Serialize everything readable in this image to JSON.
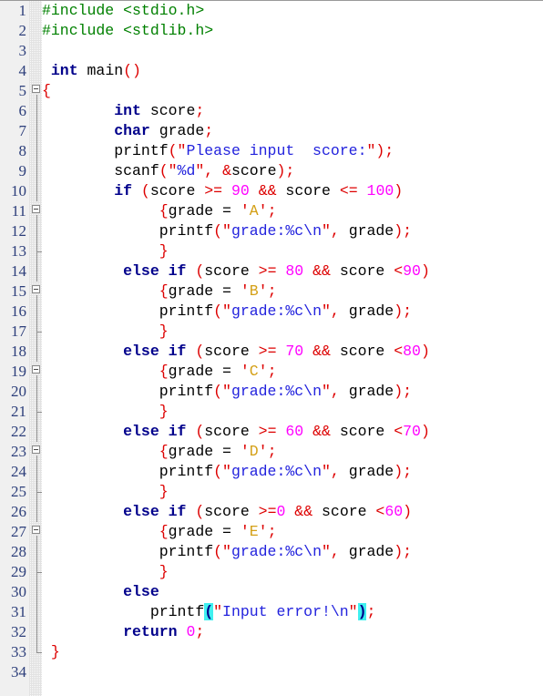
{
  "editor": {
    "language": "C",
    "gutter_background": "#F0F0F0",
    "code_background": "#FFFFFF",
    "line_height_px": 22,
    "total_visible_lines": 34,
    "bracket_match_highlight_color": "#3FF0F0",
    "colors": {
      "preprocessor": "#008000",
      "keyword": "#00008B",
      "identifier": "#000000",
      "punctuation": "#DD0000",
      "string": "#2222DD",
      "char_literal": "#D4A017",
      "number": "#FF00FF",
      "line_number": "#2C3E7A",
      "fold_line": "#8A8A8A"
    },
    "line_numbers": [
      "1",
      "2",
      "3",
      "4",
      "5",
      "6",
      "7",
      "8",
      "9",
      "10",
      "11",
      "12",
      "13",
      "14",
      "15",
      "16",
      "17",
      "18",
      "19",
      "20",
      "21",
      "22",
      "23",
      "24",
      "25",
      "26",
      "27",
      "28",
      "29",
      "30",
      "31",
      "32",
      "33",
      "34"
    ],
    "fold_markers": [
      {
        "line": 5,
        "type": "box",
        "state": "expanded"
      },
      {
        "line": 11,
        "type": "box",
        "state": "expanded"
      },
      {
        "line": 13,
        "type": "endtick",
        "state": "region-end"
      },
      {
        "line": 15,
        "type": "box",
        "state": "expanded"
      },
      {
        "line": 17,
        "type": "endtick",
        "state": "region-end"
      },
      {
        "line": 19,
        "type": "box",
        "state": "expanded"
      },
      {
        "line": 21,
        "type": "endtick",
        "state": "region-end"
      },
      {
        "line": 23,
        "type": "box",
        "state": "expanded"
      },
      {
        "line": 25,
        "type": "endtick",
        "state": "region-end"
      },
      {
        "line": 27,
        "type": "box",
        "state": "expanded"
      },
      {
        "line": 29,
        "type": "endtick",
        "state": "region-end"
      },
      {
        "line": 33,
        "type": "elbow",
        "state": "region-end"
      }
    ],
    "lines": [
      {
        "n": 1,
        "text": "#include <stdio.h>",
        "tokens": [
          {
            "t": "#include <stdio.h>",
            "c": "t-pre"
          }
        ]
      },
      {
        "n": 2,
        "text": "#include <stdlib.h>",
        "tokens": [
          {
            "t": "#include <stdlib.h>",
            "c": "t-pre"
          }
        ]
      },
      {
        "n": 3,
        "text": "",
        "tokens": []
      },
      {
        "n": 4,
        "text": " int main()",
        "tokens": [
          {
            "t": " ",
            "c": "t-id"
          },
          {
            "t": "int",
            "c": "t-kw"
          },
          {
            "t": " main",
            "c": "t-id"
          },
          {
            "t": "()",
            "c": "t-punct"
          }
        ]
      },
      {
        "n": 5,
        "text": "{",
        "tokens": [
          {
            "t": "{",
            "c": "t-punct"
          }
        ]
      },
      {
        "n": 6,
        "text": "        int score;",
        "tokens": [
          {
            "t": "        ",
            "c": "t-id"
          },
          {
            "t": "int",
            "c": "t-kw"
          },
          {
            "t": " score",
            "c": "t-id"
          },
          {
            "t": ";",
            "c": "t-punct"
          }
        ]
      },
      {
        "n": 7,
        "text": "        char grade;",
        "tokens": [
          {
            "t": "        ",
            "c": "t-id"
          },
          {
            "t": "char",
            "c": "t-kw"
          },
          {
            "t": " grade",
            "c": "t-id"
          },
          {
            "t": ";",
            "c": "t-punct"
          }
        ]
      },
      {
        "n": 8,
        "text": "        printf(\"Please input  score:\");",
        "tokens": [
          {
            "t": "        printf",
            "c": "t-id"
          },
          {
            "t": "(\"",
            "c": "t-punct"
          },
          {
            "t": "Please input  score:",
            "c": "t-str"
          },
          {
            "t": "\");",
            "c": "t-punct"
          }
        ]
      },
      {
        "n": 9,
        "text": "        scanf(\"%d\", &score);",
        "tokens": [
          {
            "t": "        scanf",
            "c": "t-id"
          },
          {
            "t": "(\"",
            "c": "t-punct"
          },
          {
            "t": "%d",
            "c": "t-str"
          },
          {
            "t": "\", &",
            "c": "t-punct"
          },
          {
            "t": "score",
            "c": "t-id"
          },
          {
            "t": ");",
            "c": "t-punct"
          }
        ]
      },
      {
        "n": 10,
        "text": "        if (score >= 90 && score <= 100)",
        "tokens": [
          {
            "t": "        ",
            "c": "t-id"
          },
          {
            "t": "if",
            "c": "t-kw"
          },
          {
            "t": " (",
            "c": "t-punct"
          },
          {
            "t": "score ",
            "c": "t-id"
          },
          {
            "t": ">=",
            "c": "t-punct"
          },
          {
            "t": " ",
            "c": "t-id"
          },
          {
            "t": "90",
            "c": "t-num"
          },
          {
            "t": " ",
            "c": "t-id"
          },
          {
            "t": "&&",
            "c": "t-punct"
          },
          {
            "t": " score ",
            "c": "t-id"
          },
          {
            "t": "<=",
            "c": "t-punct"
          },
          {
            "t": " ",
            "c": "t-id"
          },
          {
            "t": "100",
            "c": "t-num"
          },
          {
            "t": ")",
            "c": "t-punct"
          }
        ]
      },
      {
        "n": 11,
        "text": "             {grade = 'A';",
        "tokens": [
          {
            "t": "             ",
            "c": "t-id"
          },
          {
            "t": "{",
            "c": "t-punct"
          },
          {
            "t": "grade = ",
            "c": "t-id"
          },
          {
            "t": "'",
            "c": "t-punct"
          },
          {
            "t": "A",
            "c": "t-chr"
          },
          {
            "t": "';",
            "c": "t-punct"
          }
        ]
      },
      {
        "n": 12,
        "text": "             printf(\"grade:%c\\n\", grade);",
        "tokens": [
          {
            "t": "             printf",
            "c": "t-id"
          },
          {
            "t": "(\"",
            "c": "t-punct"
          },
          {
            "t": "grade:%c\\n",
            "c": "t-str"
          },
          {
            "t": "\", ",
            "c": "t-punct"
          },
          {
            "t": "grade",
            "c": "t-id"
          },
          {
            "t": ");",
            "c": "t-punct"
          }
        ]
      },
      {
        "n": 13,
        "text": "             }",
        "tokens": [
          {
            "t": "             ",
            "c": "t-id"
          },
          {
            "t": "}",
            "c": "t-punct"
          }
        ]
      },
      {
        "n": 14,
        "text": "         else if (score >= 80 && score <90)",
        "tokens": [
          {
            "t": "         ",
            "c": "t-id"
          },
          {
            "t": "else if",
            "c": "t-kw"
          },
          {
            "t": " (",
            "c": "t-punct"
          },
          {
            "t": "score ",
            "c": "t-id"
          },
          {
            "t": ">=",
            "c": "t-punct"
          },
          {
            "t": " ",
            "c": "t-id"
          },
          {
            "t": "80",
            "c": "t-num"
          },
          {
            "t": " ",
            "c": "t-id"
          },
          {
            "t": "&&",
            "c": "t-punct"
          },
          {
            "t": " score ",
            "c": "t-id"
          },
          {
            "t": "<",
            "c": "t-punct"
          },
          {
            "t": "90",
            "c": "t-num"
          },
          {
            "t": ")",
            "c": "t-punct"
          }
        ]
      },
      {
        "n": 15,
        "text": "             {grade = 'B';",
        "tokens": [
          {
            "t": "             ",
            "c": "t-id"
          },
          {
            "t": "{",
            "c": "t-punct"
          },
          {
            "t": "grade = ",
            "c": "t-id"
          },
          {
            "t": "'",
            "c": "t-punct"
          },
          {
            "t": "B",
            "c": "t-chr"
          },
          {
            "t": "';",
            "c": "t-punct"
          }
        ]
      },
      {
        "n": 16,
        "text": "             printf(\"grade:%c\\n\", grade);",
        "tokens": [
          {
            "t": "             printf",
            "c": "t-id"
          },
          {
            "t": "(\"",
            "c": "t-punct"
          },
          {
            "t": "grade:%c\\n",
            "c": "t-str"
          },
          {
            "t": "\", ",
            "c": "t-punct"
          },
          {
            "t": "grade",
            "c": "t-id"
          },
          {
            "t": ");",
            "c": "t-punct"
          }
        ]
      },
      {
        "n": 17,
        "text": "             }",
        "tokens": [
          {
            "t": "             ",
            "c": "t-id"
          },
          {
            "t": "}",
            "c": "t-punct"
          }
        ]
      },
      {
        "n": 18,
        "text": "         else if (score >= 70 && score <80)",
        "tokens": [
          {
            "t": "         ",
            "c": "t-id"
          },
          {
            "t": "else if",
            "c": "t-kw"
          },
          {
            "t": " (",
            "c": "t-punct"
          },
          {
            "t": "score ",
            "c": "t-id"
          },
          {
            "t": ">=",
            "c": "t-punct"
          },
          {
            "t": " ",
            "c": "t-id"
          },
          {
            "t": "70",
            "c": "t-num"
          },
          {
            "t": " ",
            "c": "t-id"
          },
          {
            "t": "&&",
            "c": "t-punct"
          },
          {
            "t": " score ",
            "c": "t-id"
          },
          {
            "t": "<",
            "c": "t-punct"
          },
          {
            "t": "80",
            "c": "t-num"
          },
          {
            "t": ")",
            "c": "t-punct"
          }
        ]
      },
      {
        "n": 19,
        "text": "             {grade = 'C';",
        "tokens": [
          {
            "t": "             ",
            "c": "t-id"
          },
          {
            "t": "{",
            "c": "t-punct"
          },
          {
            "t": "grade = ",
            "c": "t-id"
          },
          {
            "t": "'",
            "c": "t-punct"
          },
          {
            "t": "C",
            "c": "t-chr"
          },
          {
            "t": "';",
            "c": "t-punct"
          }
        ]
      },
      {
        "n": 20,
        "text": "             printf(\"grade:%c\\n\", grade);",
        "tokens": [
          {
            "t": "             printf",
            "c": "t-id"
          },
          {
            "t": "(\"",
            "c": "t-punct"
          },
          {
            "t": "grade:%c\\n",
            "c": "t-str"
          },
          {
            "t": "\", ",
            "c": "t-punct"
          },
          {
            "t": "grade",
            "c": "t-id"
          },
          {
            "t": ");",
            "c": "t-punct"
          }
        ]
      },
      {
        "n": 21,
        "text": "             }",
        "tokens": [
          {
            "t": "             ",
            "c": "t-id"
          },
          {
            "t": "}",
            "c": "t-punct"
          }
        ]
      },
      {
        "n": 22,
        "text": "         else if (score >= 60 && score <70)",
        "tokens": [
          {
            "t": "         ",
            "c": "t-id"
          },
          {
            "t": "else if",
            "c": "t-kw"
          },
          {
            "t": " (",
            "c": "t-punct"
          },
          {
            "t": "score ",
            "c": "t-id"
          },
          {
            "t": ">=",
            "c": "t-punct"
          },
          {
            "t": " ",
            "c": "t-id"
          },
          {
            "t": "60",
            "c": "t-num"
          },
          {
            "t": " ",
            "c": "t-id"
          },
          {
            "t": "&&",
            "c": "t-punct"
          },
          {
            "t": " score ",
            "c": "t-id"
          },
          {
            "t": "<",
            "c": "t-punct"
          },
          {
            "t": "70",
            "c": "t-num"
          },
          {
            "t": ")",
            "c": "t-punct"
          }
        ]
      },
      {
        "n": 23,
        "text": "             {grade = 'D';",
        "tokens": [
          {
            "t": "             ",
            "c": "t-id"
          },
          {
            "t": "{",
            "c": "t-punct"
          },
          {
            "t": "grade = ",
            "c": "t-id"
          },
          {
            "t": "'",
            "c": "t-punct"
          },
          {
            "t": "D",
            "c": "t-chr"
          },
          {
            "t": "';",
            "c": "t-punct"
          }
        ]
      },
      {
        "n": 24,
        "text": "             printf(\"grade:%c\\n\", grade);",
        "tokens": [
          {
            "t": "             printf",
            "c": "t-id"
          },
          {
            "t": "(\"",
            "c": "t-punct"
          },
          {
            "t": "grade:%c\\n",
            "c": "t-str"
          },
          {
            "t": "\", ",
            "c": "t-punct"
          },
          {
            "t": "grade",
            "c": "t-id"
          },
          {
            "t": ");",
            "c": "t-punct"
          }
        ]
      },
      {
        "n": 25,
        "text": "             }",
        "tokens": [
          {
            "t": "             ",
            "c": "t-id"
          },
          {
            "t": "}",
            "c": "t-punct"
          }
        ]
      },
      {
        "n": 26,
        "text": "         else if (score >=0 && score <60)",
        "tokens": [
          {
            "t": "         ",
            "c": "t-id"
          },
          {
            "t": "else if",
            "c": "t-kw"
          },
          {
            "t": " (",
            "c": "t-punct"
          },
          {
            "t": "score ",
            "c": "t-id"
          },
          {
            "t": ">=",
            "c": "t-punct"
          },
          {
            "t": "0",
            "c": "t-num"
          },
          {
            "t": " ",
            "c": "t-id"
          },
          {
            "t": "&&",
            "c": "t-punct"
          },
          {
            "t": " score ",
            "c": "t-id"
          },
          {
            "t": "<",
            "c": "t-punct"
          },
          {
            "t": "60",
            "c": "t-num"
          },
          {
            "t": ")",
            "c": "t-punct"
          }
        ]
      },
      {
        "n": 27,
        "text": "             {grade = 'E';",
        "tokens": [
          {
            "t": "             ",
            "c": "t-id"
          },
          {
            "t": "{",
            "c": "t-punct"
          },
          {
            "t": "grade = ",
            "c": "t-id"
          },
          {
            "t": "'",
            "c": "t-punct"
          },
          {
            "t": "E",
            "c": "t-chr"
          },
          {
            "t": "';",
            "c": "t-punct"
          }
        ]
      },
      {
        "n": 28,
        "text": "             printf(\"grade:%c\\n\", grade);",
        "tokens": [
          {
            "t": "             printf",
            "c": "t-id"
          },
          {
            "t": "(\"",
            "c": "t-punct"
          },
          {
            "t": "grade:%c\\n",
            "c": "t-str"
          },
          {
            "t": "\", ",
            "c": "t-punct"
          },
          {
            "t": "grade",
            "c": "t-id"
          },
          {
            "t": ");",
            "c": "t-punct"
          }
        ]
      },
      {
        "n": 29,
        "text": "             }",
        "tokens": [
          {
            "t": "             ",
            "c": "t-id"
          },
          {
            "t": "}",
            "c": "t-punct"
          }
        ]
      },
      {
        "n": 30,
        "text": "         else",
        "tokens": [
          {
            "t": "         ",
            "c": "t-id"
          },
          {
            "t": "else",
            "c": "t-kw"
          }
        ]
      },
      {
        "n": 31,
        "text": "            printf(\"Input error!\\n\");",
        "tokens": [
          {
            "t": "            printf",
            "c": "t-id"
          },
          {
            "t": "(",
            "c": "t-match"
          },
          {
            "t": "\"",
            "c": "t-punct"
          },
          {
            "t": "Input error!\\n",
            "c": "t-str"
          },
          {
            "t": "\"",
            "c": "t-punct"
          },
          {
            "t": ")",
            "c": "t-match"
          },
          {
            "t": ";",
            "c": "t-punct"
          }
        ]
      },
      {
        "n": 32,
        "text": "         return 0;",
        "tokens": [
          {
            "t": "         ",
            "c": "t-id"
          },
          {
            "t": "return",
            "c": "t-kw"
          },
          {
            "t": " ",
            "c": "t-id"
          },
          {
            "t": "0",
            "c": "t-num"
          },
          {
            "t": ";",
            "c": "t-punct"
          }
        ]
      },
      {
        "n": 33,
        "text": " }",
        "tokens": [
          {
            "t": " ",
            "c": "t-id"
          },
          {
            "t": "}",
            "c": "t-punct"
          }
        ]
      },
      {
        "n": 34,
        "text": "",
        "tokens": []
      }
    ]
  }
}
